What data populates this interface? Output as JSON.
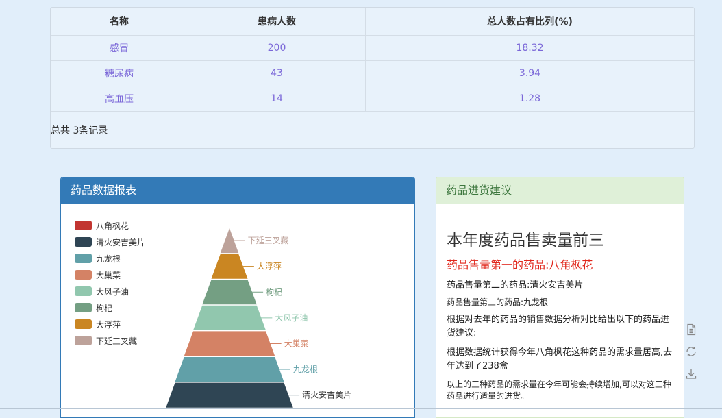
{
  "table": {
    "headers": [
      "名称",
      "患病人数",
      "总人数占有比列(%)"
    ],
    "rows": [
      [
        "感冒",
        "200",
        "18.32"
      ],
      [
        "糖尿病",
        "43",
        "3.94"
      ],
      [
        "高血压",
        "14",
        "1.28"
      ]
    ],
    "total": "总共 3条记录"
  },
  "chart_panel": {
    "title": "药品数据报表"
  },
  "chart_data": {
    "type": "funnel",
    "legend_position": "top-left",
    "legend": [
      {
        "name": "八角枫花",
        "color": "#c23531"
      },
      {
        "name": "清火安吉美片",
        "color": "#2f4554"
      },
      {
        "name": "九龙根",
        "color": "#61a0a8"
      },
      {
        "name": "大巢菜",
        "color": "#d48265"
      },
      {
        "name": "大风子油",
        "color": "#91c7ae"
      },
      {
        "name": "枸杞",
        "color": "#749f83"
      },
      {
        "name": "大浮萍",
        "color": "#ca8622"
      },
      {
        "name": "下延三叉藏",
        "color": "#bda29a"
      }
    ],
    "levels_top_to_bottom": [
      "下延三叉藏",
      "大浮萍",
      "枸杞",
      "大风子油",
      "大巢菜",
      "九龙根",
      "清火安吉美片"
    ]
  },
  "advice_panel": {
    "title": "药品进货建议",
    "heading": "本年度药品售卖量前三",
    "first": "药品售量第一的药品:八角枫花",
    "second": "药品售量第二的药品:清火安吉美片",
    "third": "药品售量第三的药品:九龙根",
    "analysis": "根据对去年的药品的销售数据分析对比给出以下的药品进货建议:",
    "stat": "根据数据统计获得今年八角枫花这种药品的需求量居高,去年达到了238盒",
    "conclusion": "以上的三种药品的需求量在今年可能会持续增加,可以对这三种药品进行适量的进货。"
  },
  "toolbox": [
    "data-view-icon",
    "restore-icon",
    "save-image-icon"
  ]
}
